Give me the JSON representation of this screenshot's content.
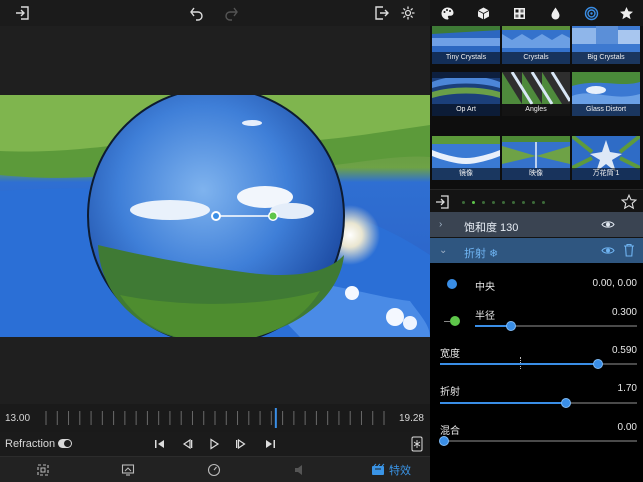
{
  "toolbar": {
    "icons": [
      "import-icon",
      "undo-icon",
      "redo-icon",
      "export-icon",
      "gear-icon"
    ]
  },
  "categories": {
    "icons": [
      "palette-icon",
      "cube-icon",
      "texture-icon",
      "drop-icon",
      "swirl-icon",
      "star-icon"
    ],
    "active": "swirl-icon",
    "accent": "#3a8ee6"
  },
  "thumbnails": [
    {
      "label": "Tiny Crystals"
    },
    {
      "label": "Crystals"
    },
    {
      "label": "Big Crystals"
    },
    {
      "label": "Op Art"
    },
    {
      "label": "Angles"
    },
    {
      "label": "Glass Distort"
    },
    {
      "label": "镜像"
    },
    {
      "label": "映像"
    },
    {
      "label": "万花筒 1"
    }
  ],
  "pager": {
    "count": 9,
    "active_index": 1
  },
  "layers": [
    {
      "name": "饱和度 130",
      "expanded": false
    },
    {
      "name": "折射 ❄",
      "expanded": true
    }
  ],
  "params": {
    "center": {
      "label": "中央",
      "value": "0.00, 0.00",
      "color": "#3a8ee6"
    },
    "radius": {
      "label": "半径",
      "value": "0.300",
      "level": 0.22,
      "color": "#5ec64a"
    },
    "width": {
      "label": "宽度",
      "value": "0.590",
      "level": 0.8
    },
    "refraction": {
      "label": "折射",
      "value": "1.70",
      "level": 0.64
    },
    "blend": {
      "label": "混合",
      "value": "0.00",
      "level": 0.0
    }
  },
  "timeline": {
    "start": "13.00",
    "end": "19.28",
    "playhead": 0.68
  },
  "playback": {
    "effect_label": "Refraction",
    "icons": [
      "skip-start-icon",
      "step-back-icon",
      "play-icon",
      "step-forward-icon",
      "skip-end-icon",
      "freeze-icon"
    ]
  },
  "tabs": [
    {
      "icon": "crop-icon",
      "label": ""
    },
    {
      "icon": "display-icon",
      "label": ""
    },
    {
      "icon": "speed-icon",
      "label": ""
    },
    {
      "icon": "audio-icon",
      "label": ""
    },
    {
      "icon": "effects-icon",
      "label": "特效"
    }
  ]
}
